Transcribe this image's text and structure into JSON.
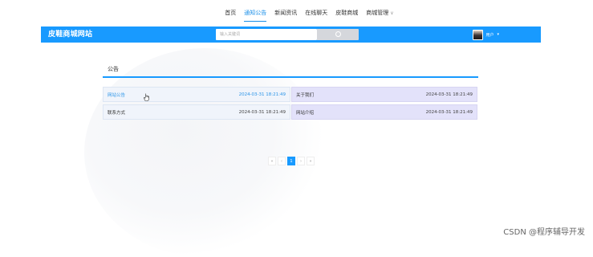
{
  "topnav": {
    "items": [
      {
        "label": "首页"
      },
      {
        "label": "通知公告"
      },
      {
        "label": "新闻资讯"
      },
      {
        "label": "在线聊天"
      },
      {
        "label": "皮鞋商城"
      },
      {
        "label": "商城管理"
      }
    ],
    "active_index": 1
  },
  "header": {
    "site_title": "皮鞋商城网站",
    "search_placeholder": "输入关键词",
    "user_label": "用户",
    "accent_color": "#189aff"
  },
  "section": {
    "title": "公告"
  },
  "notices": [
    {
      "title": "网站公告",
      "date": "2024-03-31 18:21:49"
    },
    {
      "title": "关于我们",
      "date": "2024-03-31 18:21:49"
    },
    {
      "title": "联系方式",
      "date": "2024-03-31 18:21:49"
    },
    {
      "title": "网站介绍",
      "date": "2024-03-31 18:21:49"
    }
  ],
  "pagination": {
    "first": "«",
    "prev": "‹",
    "current": "1",
    "next": "›",
    "last": "»"
  },
  "watermark": "CSDN @程序辅导开发"
}
